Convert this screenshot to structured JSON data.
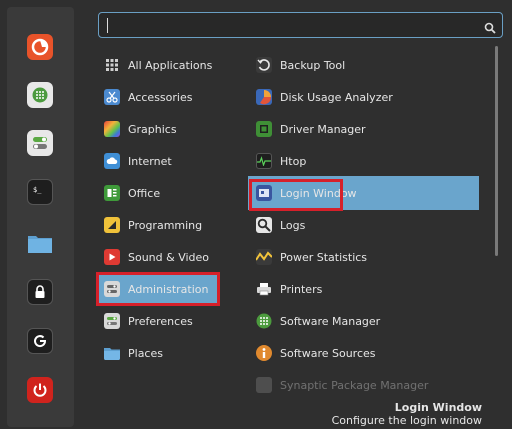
{
  "search": {
    "value": ""
  },
  "categories": [
    {
      "label": "All Applications",
      "icon": "grid-icon"
    },
    {
      "label": "Accessories",
      "icon": "scissors-icon"
    },
    {
      "label": "Graphics",
      "icon": "graphics-icon"
    },
    {
      "label": "Internet",
      "icon": "cloud-icon"
    },
    {
      "label": "Office",
      "icon": "office-icon"
    },
    {
      "label": "Programming",
      "icon": "programming-icon"
    },
    {
      "label": "Sound & Video",
      "icon": "play-icon"
    },
    {
      "label": "Administration",
      "icon": "administration-icon"
    },
    {
      "label": "Preferences",
      "icon": "preferences-icon"
    },
    {
      "label": "Places",
      "icon": "folder-icon"
    }
  ],
  "apps": [
    {
      "label": "Backup Tool",
      "icon": "backup-icon"
    },
    {
      "label": "Disk Usage Analyzer",
      "icon": "disk-usage-icon"
    },
    {
      "label": "Driver Manager",
      "icon": "chip-icon"
    },
    {
      "label": "Htop",
      "icon": "htop-icon"
    },
    {
      "label": "Login Window",
      "icon": "login-window-icon"
    },
    {
      "label": "Logs",
      "icon": "magnifier-icon"
    },
    {
      "label": "Power Statistics",
      "icon": "power-statistics-icon"
    },
    {
      "label": "Printers",
      "icon": "printer-icon"
    },
    {
      "label": "Software Manager",
      "icon": "software-manager-icon"
    },
    {
      "label": "Software Sources",
      "icon": "software-sources-icon"
    },
    {
      "label": "Synaptic Package Manager",
      "icon": "synaptic-icon"
    }
  ],
  "favorites": [
    {
      "name": "firefox-icon",
      "color": "#e8532a"
    },
    {
      "name": "software-manager-icon",
      "color": "#4c9b3e"
    },
    {
      "name": "settings-toggle-icon",
      "color": "#5aa843"
    },
    {
      "name": "terminal-icon",
      "color": "#1e1e1e"
    },
    {
      "name": "files-folder-icon",
      "color": "#5d9fd0"
    },
    {
      "name": "lock-screen-icon",
      "color": "#1e1e1e"
    },
    {
      "name": "logout-icon",
      "color": "#1e1e1e"
    },
    {
      "name": "shutdown-icon",
      "color": "#d0231d"
    }
  ],
  "selected": {
    "category": "Administration",
    "app": "Login Window"
  },
  "description": {
    "title": "Login Window",
    "subtitle": "Configure the login window"
  },
  "colors": {
    "highlight": "#6aa5cc",
    "annotation": "#d6202a",
    "search_border": "#6a9fc4"
  }
}
